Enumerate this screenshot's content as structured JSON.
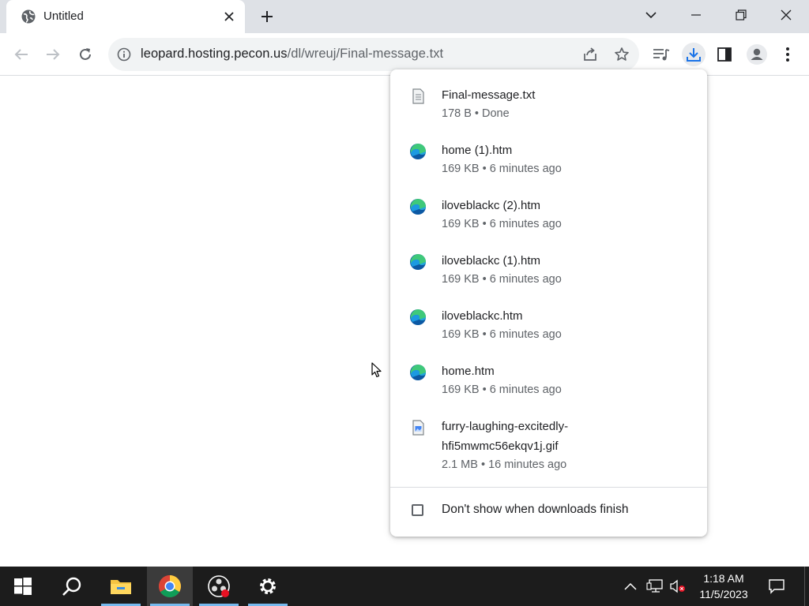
{
  "tab": {
    "title": "Untitled"
  },
  "address_bar": {
    "url_host": "leopard.hosting.pecon.us",
    "url_path": "/dl/wreuj/Final-message.txt"
  },
  "downloads": {
    "items": [
      {
        "name": "Final-message.txt",
        "status": "178 B • Done",
        "icon": "text-file-icon"
      },
      {
        "name": "home (1).htm",
        "status": "169 KB • 6 minutes ago",
        "icon": "edge-icon"
      },
      {
        "name": "iloveblackc (2).htm",
        "status": "169 KB • 6 minutes ago",
        "icon": "edge-icon"
      },
      {
        "name": "iloveblackc (1).htm",
        "status": "169 KB • 6 minutes ago",
        "icon": "edge-icon"
      },
      {
        "name": "iloveblackc.htm",
        "status": "169 KB • 6 minutes ago",
        "icon": "edge-icon"
      },
      {
        "name": "home.htm",
        "status": "169 KB • 6 minutes ago",
        "icon": "edge-icon"
      },
      {
        "name_line1": "furry-laughing-excitedly-",
        "name_line2": "hfi5mwmc56ekqv1j.gif",
        "status": "2.1 MB • 16 minutes ago",
        "icon": "image-file-icon"
      }
    ],
    "checkbox_label": "Don't show when downloads finish",
    "checkbox_checked": false
  },
  "taskbar": {
    "time": "1:18 AM",
    "date": "11/5/2023"
  },
  "colors": {
    "tabstrip_bg": "#dee1e6",
    "accent_blue": "#1a73e8",
    "taskbar_bg": "#1c1c1c"
  }
}
